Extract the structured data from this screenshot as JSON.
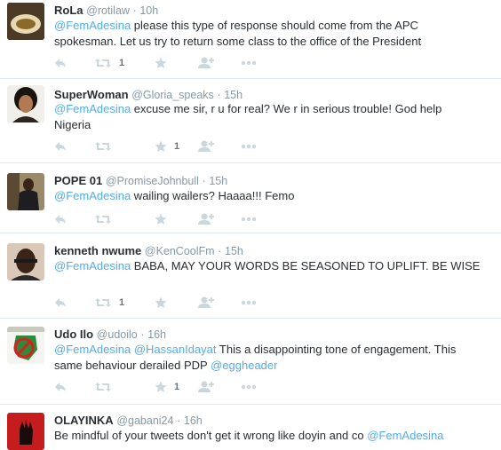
{
  "colors": {
    "link": "#55acee",
    "meta": "#8899a6",
    "icon": "#ccd6dd",
    "divider": "#e1e8ed"
  },
  "tweets": [
    {
      "name": "RoLa",
      "handle": "@rotilaw",
      "dot": "·",
      "time": "10h",
      "body": [
        {
          "text": "@FemAdesina",
          "mention": true
        },
        {
          "text": " please this type of response should come from the APC spokesman. Let us try to return some class to the office of the President",
          "mention": false
        }
      ],
      "retweets": "1",
      "likes": ""
    },
    {
      "name": "SuperWoman",
      "handle": "@Gloria_speaks",
      "dot": "·",
      "time": "15h",
      "body": [
        {
          "text": "@FemAdesina",
          "mention": true
        },
        {
          "text": " excuse me sir, r u for real? We r in serious trouble! God help Nigeria",
          "mention": false
        }
      ],
      "retweets": "",
      "likes": "1"
    },
    {
      "name": "POPE 01",
      "handle": "@PromiseJohnbull",
      "dot": "·",
      "time": "15h",
      "body": [
        {
          "text": "@FemAdesina",
          "mention": true
        },
        {
          "text": " wailing wailers? Haaaa!!! Femo",
          "mention": false
        }
      ],
      "retweets": "",
      "likes": ""
    },
    {
      "name": "kenneth nwume",
      "handle": "@KenCoolFm",
      "dot": "·",
      "time": "15h",
      "body": [
        {
          "text": "@FemAdesina",
          "mention": true
        },
        {
          "text": " BABA, MAY YOUR WORDS BE SEASONED TO UPLIFT. BE WISE",
          "mention": false
        }
      ],
      "retweets": "1",
      "likes": ""
    },
    {
      "name": "Udo Ilo",
      "handle": "@udoilo",
      "dot": "·",
      "time": "16h",
      "body": [
        {
          "text": "@FemAdesina",
          "mention": true
        },
        {
          "text": " ",
          "mention": false
        },
        {
          "text": "@HassanIdayat",
          "mention": true
        },
        {
          "text": " This a disappointing tone of engagement. This same behaviour derailed PDP ",
          "mention": false
        },
        {
          "text": "@eggheader",
          "mention": true
        }
      ],
      "retweets": "",
      "likes": "1"
    },
    {
      "name": "OLAYINKA",
      "handle": "@gabani24",
      "dot": "·",
      "time": "16h",
      "body": [
        {
          "text": "Be mindful of your tweets don't get it wrong like doyin and co ",
          "mention": false
        },
        {
          "text": "@FemAdesina",
          "mention": true
        }
      ],
      "retweets": "",
      "likes": ""
    }
  ]
}
